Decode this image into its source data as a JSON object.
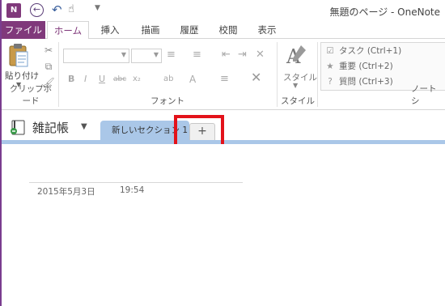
{
  "window": {
    "title": "無題のページ - OneNote",
    "app_icon_text": "N"
  },
  "ribbon_tabs": [
    "ファイル",
    "ホーム",
    "挿入",
    "描画",
    "履歴",
    "校閲",
    "表示"
  ],
  "clipboard": {
    "paste_label": "貼り付け",
    "group_label": "クリップボード"
  },
  "font": {
    "group_label": "フォント",
    "bold": "B",
    "italic": "I",
    "underline": "U",
    "strike": "abc",
    "subscript": "x₂",
    "highlight": "ab",
    "font_color": "A"
  },
  "styles": {
    "label": "スタイル",
    "group_label": "スタイル"
  },
  "tags": {
    "items": [
      "タスク (Ctrl+1)",
      "重要 (Ctrl+2)",
      "質問 (Ctrl+3)"
    ],
    "group_label": "ノート シ"
  },
  "notebook": {
    "name": "雑記帳",
    "section_tab": "新しいセクション 1",
    "add_tab": "+"
  },
  "page": {
    "date": "2015年5月3日",
    "time": "19:54"
  },
  "colors": {
    "onenote_purple": "#80397b",
    "section_blue": "#aac7e8",
    "highlight_red": "#e3121a"
  }
}
